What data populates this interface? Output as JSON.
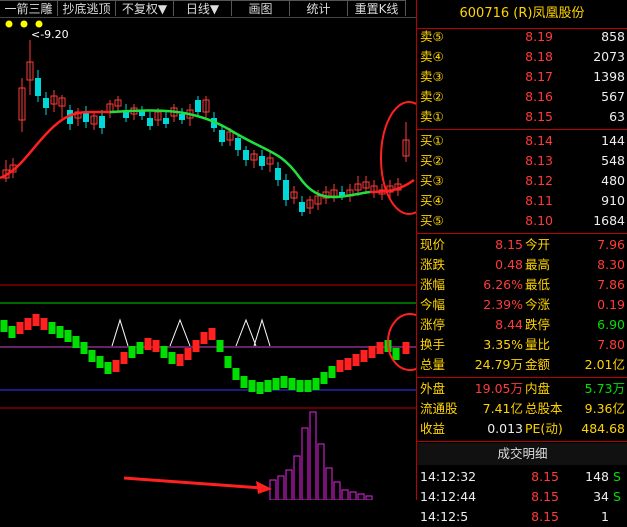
{
  "toolbar": [
    "一箭三雕",
    "抄底逃顶",
    "不复权▼",
    "日线▼",
    "画图",
    "统计",
    "重置K线"
  ],
  "chart_annotation": "<-9.20",
  "stock": {
    "code": "600716",
    "name": "(R)凤凰股份"
  },
  "sell_orders": [
    {
      "label": "卖⑤",
      "price": "8.19",
      "vol": "858"
    },
    {
      "label": "卖④",
      "price": "8.18",
      "vol": "2073"
    },
    {
      "label": "卖③",
      "price": "8.17",
      "vol": "1398"
    },
    {
      "label": "卖②",
      "price": "8.16",
      "vol": "567"
    },
    {
      "label": "卖①",
      "price": "8.15",
      "vol": "63"
    }
  ],
  "buy_orders": [
    {
      "label": "买①",
      "price": "8.14",
      "vol": "144"
    },
    {
      "label": "买②",
      "price": "8.13",
      "vol": "548"
    },
    {
      "label": "买③",
      "price": "8.12",
      "vol": "480"
    },
    {
      "label": "买④",
      "price": "8.11",
      "vol": "910"
    },
    {
      "label": "买⑤",
      "price": "8.10",
      "vol": "1684"
    }
  ],
  "quote": [
    {
      "l1": "现价",
      "v1": "8.15",
      "l2": "今开",
      "v2": "7.96",
      "c1": "red",
      "c2": "red"
    },
    {
      "l1": "涨跌",
      "v1": "0.48",
      "l2": "最高",
      "v2": "8.30",
      "c1": "red",
      "c2": "red"
    },
    {
      "l1": "涨幅",
      "v1": "6.26%",
      "l2": "最低",
      "v2": "7.86",
      "c1": "red",
      "c2": "red"
    },
    {
      "l1": "今幅",
      "v1": "2.39%",
      "l2": "今涨",
      "v2": "0.19",
      "c1": "red",
      "c2": "red"
    },
    {
      "l1": "涨停",
      "v1": "8.44",
      "l2": "跌停",
      "v2": "6.90",
      "c1": "red",
      "c2": "grn"
    },
    {
      "l1": "换手",
      "v1": "3.35%",
      "l2": "量比",
      "v2": "7.80",
      "c1": "yel",
      "c2": "red"
    },
    {
      "l1": "总量",
      "v1": "24.79万",
      "l2": "金额",
      "v2": "2.01亿",
      "c1": "yel",
      "c2": "yel"
    }
  ],
  "extra": [
    {
      "l1": "外盘",
      "v1": "19.05万",
      "l2": "内盘",
      "v2": "5.73万",
      "c1": "red",
      "c2": "grn"
    },
    {
      "l1": "流通股",
      "v1": "7.41亿",
      "l2": "总股本",
      "v2": "9.36亿",
      "c1": "yel",
      "c2": "yel"
    },
    {
      "l1": "收益",
      "v1": "0.013",
      "l2": "PE(动)",
      "v2": "484.68",
      "c1": "wht",
      "c2": "yel"
    }
  ],
  "detail_title": "成交明细",
  "trades": [
    {
      "time": "14:12:32",
      "price": "8.15",
      "vol": "148",
      "dir": "S"
    },
    {
      "time": "14:12:44",
      "price": "8.15",
      "vol": "34",
      "dir": "S"
    },
    {
      "time": "14:12:5",
      "price": "8.15",
      "vol": "1",
      "dir": ""
    }
  ]
}
